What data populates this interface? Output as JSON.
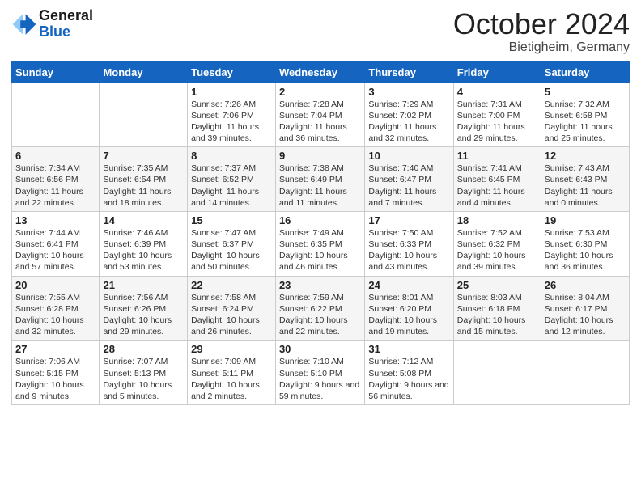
{
  "header": {
    "logo_line1": "General",
    "logo_line2": "Blue",
    "title": "October 2024",
    "subtitle": "Bietigheim, Germany"
  },
  "days_of_week": [
    "Sunday",
    "Monday",
    "Tuesday",
    "Wednesday",
    "Thursday",
    "Friday",
    "Saturday"
  ],
  "weeks": [
    [
      {
        "day": "",
        "detail": ""
      },
      {
        "day": "",
        "detail": ""
      },
      {
        "day": "1",
        "detail": "Sunrise: 7:26 AM\nSunset: 7:06 PM\nDaylight: 11 hours and 39 minutes."
      },
      {
        "day": "2",
        "detail": "Sunrise: 7:28 AM\nSunset: 7:04 PM\nDaylight: 11 hours and 36 minutes."
      },
      {
        "day": "3",
        "detail": "Sunrise: 7:29 AM\nSunset: 7:02 PM\nDaylight: 11 hours and 32 minutes."
      },
      {
        "day": "4",
        "detail": "Sunrise: 7:31 AM\nSunset: 7:00 PM\nDaylight: 11 hours and 29 minutes."
      },
      {
        "day": "5",
        "detail": "Sunrise: 7:32 AM\nSunset: 6:58 PM\nDaylight: 11 hours and 25 minutes."
      }
    ],
    [
      {
        "day": "6",
        "detail": "Sunrise: 7:34 AM\nSunset: 6:56 PM\nDaylight: 11 hours and 22 minutes."
      },
      {
        "day": "7",
        "detail": "Sunrise: 7:35 AM\nSunset: 6:54 PM\nDaylight: 11 hours and 18 minutes."
      },
      {
        "day": "8",
        "detail": "Sunrise: 7:37 AM\nSunset: 6:52 PM\nDaylight: 11 hours and 14 minutes."
      },
      {
        "day": "9",
        "detail": "Sunrise: 7:38 AM\nSunset: 6:49 PM\nDaylight: 11 hours and 11 minutes."
      },
      {
        "day": "10",
        "detail": "Sunrise: 7:40 AM\nSunset: 6:47 PM\nDaylight: 11 hours and 7 minutes."
      },
      {
        "day": "11",
        "detail": "Sunrise: 7:41 AM\nSunset: 6:45 PM\nDaylight: 11 hours and 4 minutes."
      },
      {
        "day": "12",
        "detail": "Sunrise: 7:43 AM\nSunset: 6:43 PM\nDaylight: 11 hours and 0 minutes."
      }
    ],
    [
      {
        "day": "13",
        "detail": "Sunrise: 7:44 AM\nSunset: 6:41 PM\nDaylight: 10 hours and 57 minutes."
      },
      {
        "day": "14",
        "detail": "Sunrise: 7:46 AM\nSunset: 6:39 PM\nDaylight: 10 hours and 53 minutes."
      },
      {
        "day": "15",
        "detail": "Sunrise: 7:47 AM\nSunset: 6:37 PM\nDaylight: 10 hours and 50 minutes."
      },
      {
        "day": "16",
        "detail": "Sunrise: 7:49 AM\nSunset: 6:35 PM\nDaylight: 10 hours and 46 minutes."
      },
      {
        "day": "17",
        "detail": "Sunrise: 7:50 AM\nSunset: 6:33 PM\nDaylight: 10 hours and 43 minutes."
      },
      {
        "day": "18",
        "detail": "Sunrise: 7:52 AM\nSunset: 6:32 PM\nDaylight: 10 hours and 39 minutes."
      },
      {
        "day": "19",
        "detail": "Sunrise: 7:53 AM\nSunset: 6:30 PM\nDaylight: 10 hours and 36 minutes."
      }
    ],
    [
      {
        "day": "20",
        "detail": "Sunrise: 7:55 AM\nSunset: 6:28 PM\nDaylight: 10 hours and 32 minutes."
      },
      {
        "day": "21",
        "detail": "Sunrise: 7:56 AM\nSunset: 6:26 PM\nDaylight: 10 hours and 29 minutes."
      },
      {
        "day": "22",
        "detail": "Sunrise: 7:58 AM\nSunset: 6:24 PM\nDaylight: 10 hours and 26 minutes."
      },
      {
        "day": "23",
        "detail": "Sunrise: 7:59 AM\nSunset: 6:22 PM\nDaylight: 10 hours and 22 minutes."
      },
      {
        "day": "24",
        "detail": "Sunrise: 8:01 AM\nSunset: 6:20 PM\nDaylight: 10 hours and 19 minutes."
      },
      {
        "day": "25",
        "detail": "Sunrise: 8:03 AM\nSunset: 6:18 PM\nDaylight: 10 hours and 15 minutes."
      },
      {
        "day": "26",
        "detail": "Sunrise: 8:04 AM\nSunset: 6:17 PM\nDaylight: 10 hours and 12 minutes."
      }
    ],
    [
      {
        "day": "27",
        "detail": "Sunrise: 7:06 AM\nSunset: 5:15 PM\nDaylight: 10 hours and 9 minutes."
      },
      {
        "day": "28",
        "detail": "Sunrise: 7:07 AM\nSunset: 5:13 PM\nDaylight: 10 hours and 5 minutes."
      },
      {
        "day": "29",
        "detail": "Sunrise: 7:09 AM\nSunset: 5:11 PM\nDaylight: 10 hours and 2 minutes."
      },
      {
        "day": "30",
        "detail": "Sunrise: 7:10 AM\nSunset: 5:10 PM\nDaylight: 9 hours and 59 minutes."
      },
      {
        "day": "31",
        "detail": "Sunrise: 7:12 AM\nSunset: 5:08 PM\nDaylight: 9 hours and 56 minutes."
      },
      {
        "day": "",
        "detail": ""
      },
      {
        "day": "",
        "detail": ""
      }
    ]
  ]
}
